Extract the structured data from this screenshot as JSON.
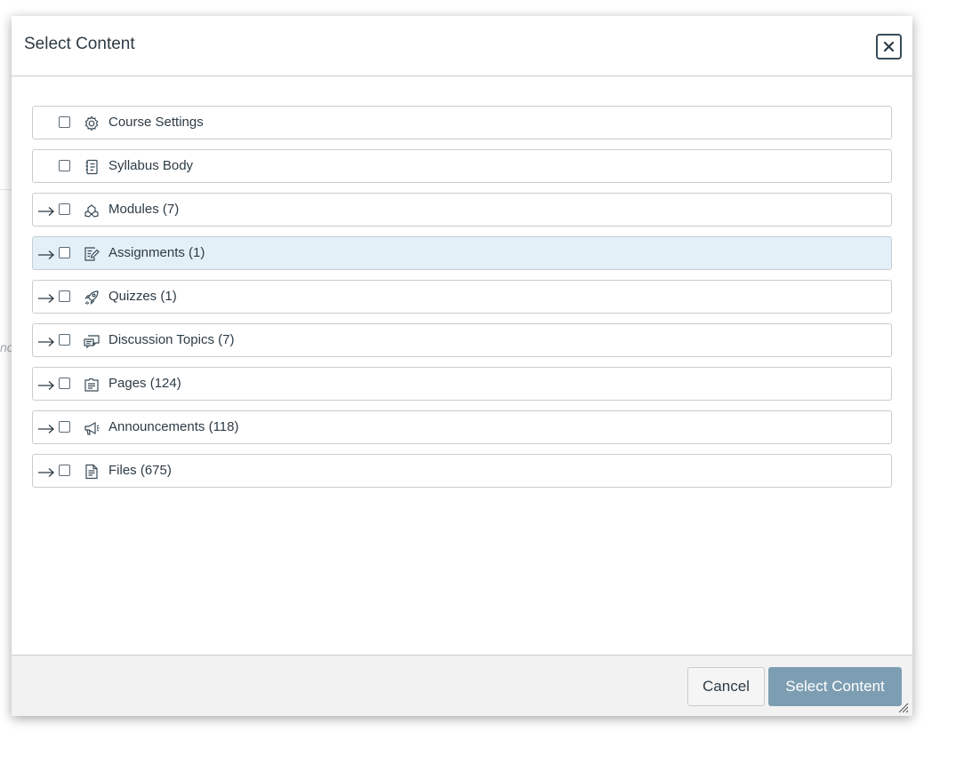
{
  "dialog": {
    "title": "Select Content",
    "close_icon": "close-icon"
  },
  "background": {
    "partial_text": "no"
  },
  "items": [
    {
      "label": "Course Settings",
      "icon": "gear-icon",
      "expandable": false,
      "highlighted": false
    },
    {
      "label": "Syllabus Body",
      "icon": "syllabus-icon",
      "expandable": false,
      "highlighted": false
    },
    {
      "label": "Modules (7)",
      "icon": "modules-icon",
      "expandable": true,
      "highlighted": false
    },
    {
      "label": "Assignments (1)",
      "icon": "assignment-icon",
      "expandable": true,
      "highlighted": true
    },
    {
      "label": "Quizzes (1)",
      "icon": "quiz-rocket-icon",
      "expandable": true,
      "highlighted": false
    },
    {
      "label": "Discussion Topics (7)",
      "icon": "discussion-icon",
      "expandable": true,
      "highlighted": false
    },
    {
      "label": "Pages (124)",
      "icon": "pages-icon",
      "expandable": true,
      "highlighted": false
    },
    {
      "label": "Announcements (118)",
      "icon": "announcement-icon",
      "expandable": true,
      "highlighted": false
    },
    {
      "label": "Files (675)",
      "icon": "file-icon",
      "expandable": true,
      "highlighted": false
    }
  ],
  "footer": {
    "cancel_label": "Cancel",
    "submit_label": "Select Content"
  },
  "colors": {
    "highlight": "#e4f0f7",
    "primary_disabled": "#7d9eb2",
    "border": "#c7cdd1"
  }
}
